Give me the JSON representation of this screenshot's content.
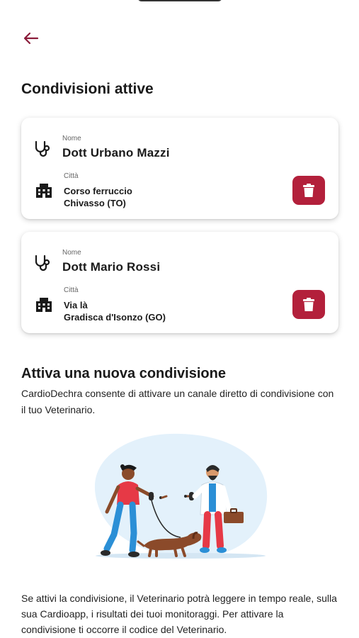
{
  "header": {
    "back_icon": "arrow-left-icon",
    "accent_color": "#8b1c3a"
  },
  "active_shares": {
    "title": "Condivisioni attive",
    "items": [
      {
        "name_label": "Nome",
        "name": "Dott Urbano Mazzi",
        "city_label": "Città",
        "address_line1": "Corso ferruccio",
        "address_line2": "Chivasso (TO)",
        "delete_icon": "trash-icon"
      },
      {
        "name_label": "Nome",
        "name": "Dott Mario Rossi",
        "city_label": "Città",
        "address_line1": "Via là",
        "address_line2": "Gradisca d'Isonzo (GO)",
        "delete_icon": "trash-icon"
      }
    ]
  },
  "new_share": {
    "title": "Attiva una nuova condivisione",
    "description": "CardioDechra consente di attivare un canale diretto di condivisione con il tuo Veterinario.",
    "footer": "Se attivi la condivisione, il Veterinario potrà leggere in tempo reale, sulla sua Cardioapp, i risultati dei tuoi monitoraggi. Per attivare la condivisione ti occorre il codice del Veterinario."
  },
  "colors": {
    "delete_button": "#b3203b",
    "illustration_bg": "#e3f1fb"
  }
}
